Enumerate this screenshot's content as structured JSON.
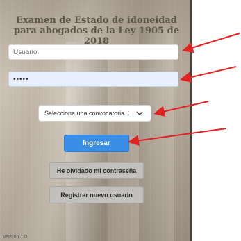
{
  "form": {
    "title": "Examen de Estado de idoneidad para abogados de la Ley 1905 de 2018",
    "username_placeholder": "Usuario",
    "password_value": "•••••",
    "convocatoria_select": "Seleccione una convocatoria...",
    "login_button": "Ingresar",
    "forgot_password_button": "He olvidado mi contraseña",
    "register_button": "Registrar nuevo usuario",
    "footer_text": "Versión 1.0"
  },
  "colors": {
    "primary_button": "#3a8ee6",
    "secondary_button": "#c2c0bd",
    "annotation_arrow": "#e02424"
  }
}
